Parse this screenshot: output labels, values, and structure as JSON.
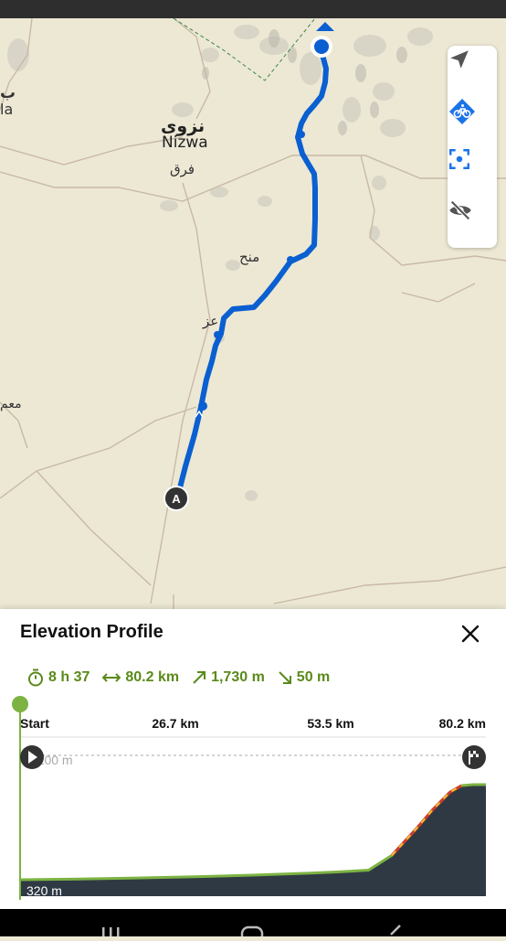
{
  "map": {
    "labels": {
      "nizwa_ar": "نزوى",
      "nizwa_en": "Nizwa",
      "fariq": "فرق",
      "manah": "منح",
      "izz": "عز",
      "maam": "معم",
      "edge_ar": "ب",
      "edge_en": "la"
    },
    "route_color": "#0a5fd1",
    "start_marker": "A",
    "controls": [
      {
        "name": "navigate-arrow-icon",
        "color": "#555555"
      },
      {
        "name": "bike-layer-icon",
        "color": "#1a73e8"
      },
      {
        "name": "focus-frame-icon",
        "color": "#1a73e8"
      },
      {
        "name": "eye-off-icon",
        "color": "#555555"
      }
    ]
  },
  "elevation_panel": {
    "title": "Elevation Profile",
    "stats": {
      "duration": "8 h 37",
      "distance": "80.2 km",
      "ascent": "1,730 m",
      "descent": "50 m"
    },
    "accent_color": "#5a8a1a"
  },
  "chart_data": {
    "type": "area",
    "x_unit": "km",
    "y_unit": "m",
    "x_ticks": [
      "Start",
      "26.7 km",
      "53.5 km",
      "80.2 km"
    ],
    "y_labels": [
      "2,200 m",
      "320 m"
    ],
    "ylim": [
      320,
      2200
    ],
    "xlim": [
      0,
      80.2
    ],
    "x": [
      0,
      10,
      20,
      30,
      40,
      50,
      55,
      60,
      64,
      68,
      71,
      74,
      76,
      78,
      80.2
    ],
    "y": [
      320,
      335,
      355,
      380,
      410,
      450,
      475,
      510,
      800,
      1300,
      1700,
      2050,
      2180,
      2200,
      2200
    ],
    "steep_segment_km": [
      64,
      76
    ]
  }
}
